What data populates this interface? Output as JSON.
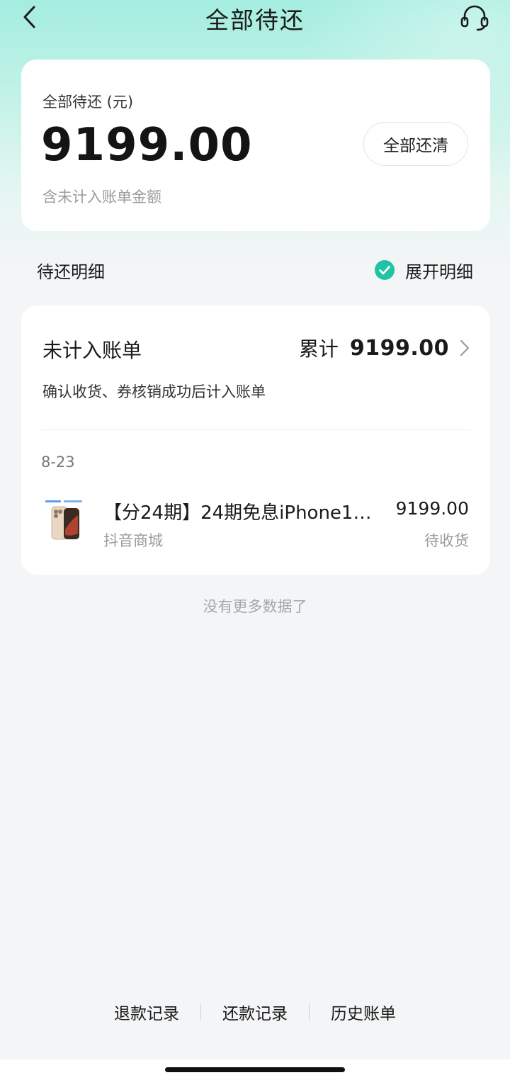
{
  "header": {
    "title": "全部待还"
  },
  "summary": {
    "label": "全部待还 (元)",
    "amount": "9199.00",
    "note": "含未计入账单金额",
    "pay_all_button": "全部还清"
  },
  "detail_section": {
    "title": "待还明细",
    "expand_label": "展开明细",
    "expand_checked": true
  },
  "unbilled": {
    "title": "未计入账单",
    "total_label": "累计",
    "total_value": "9199.00",
    "description": "确认收货、券核销成功后计入账单",
    "date": "8-23",
    "item": {
      "name": "【分24期】24期免息iPhone1…",
      "shop": "抖音商城",
      "price": "9199.00",
      "status": "待收货"
    }
  },
  "no_more": "没有更多数据了",
  "bottom_links": [
    "退款记录",
    "还款记录",
    "历史账单"
  ],
  "colors": {
    "accent": "#20c4a4",
    "header_gradient_top": "#a4ede0",
    "background": "#f4f5f7"
  }
}
